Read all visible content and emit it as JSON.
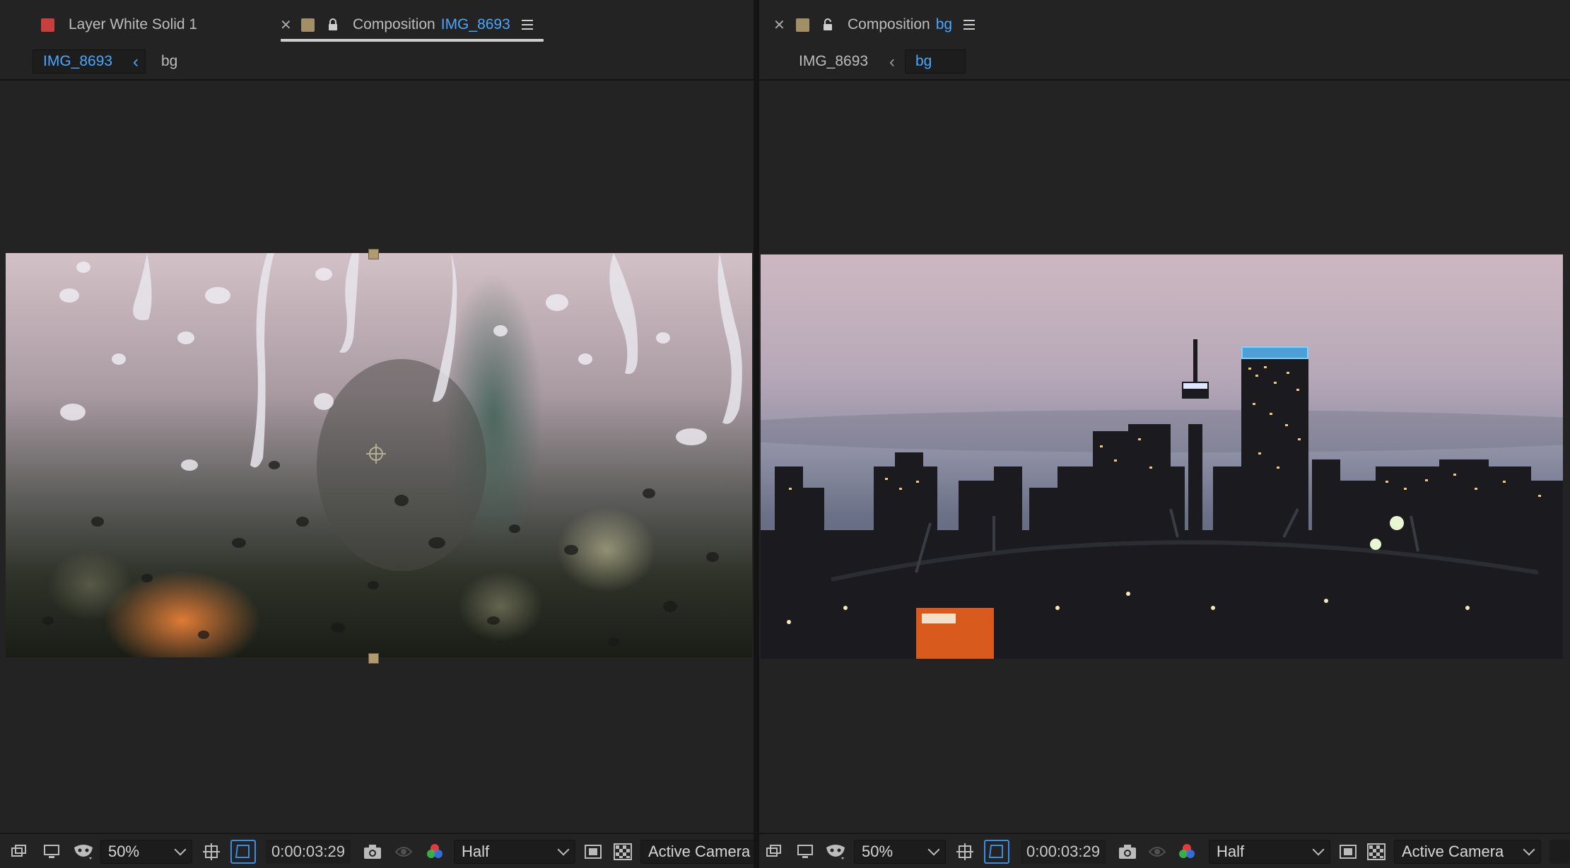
{
  "left_panel": {
    "layer_tab": {
      "label": "Layer White Solid 1",
      "swatch_color": "#c8403d"
    },
    "comp_tab": {
      "prefix": "Composition",
      "name": "IMG_8693",
      "swatch_color": "#a28f67"
    },
    "breadcrumbs": {
      "first": "IMG_8693",
      "second": "bg"
    },
    "zoom": "50%",
    "timecode": "0:00:03:29",
    "resolution": "Half",
    "camera": "Active Camera"
  },
  "right_panel": {
    "comp_tab": {
      "prefix": "Composition",
      "name": "bg",
      "swatch_color": "#a28f67"
    },
    "breadcrumbs": {
      "first": "IMG_8693",
      "second": "bg"
    },
    "zoom": "50%",
    "timecode": "0:00:03:29",
    "resolution": "Half",
    "camera": "Active Camera"
  },
  "accent_color": "#4aa7ff",
  "icons": {
    "close": "close-icon",
    "lock": "lock-icon",
    "menu": "panel-menu-icon",
    "snapshot": "camera-snapshot-icon",
    "channels": "rgb-channels-icon"
  }
}
